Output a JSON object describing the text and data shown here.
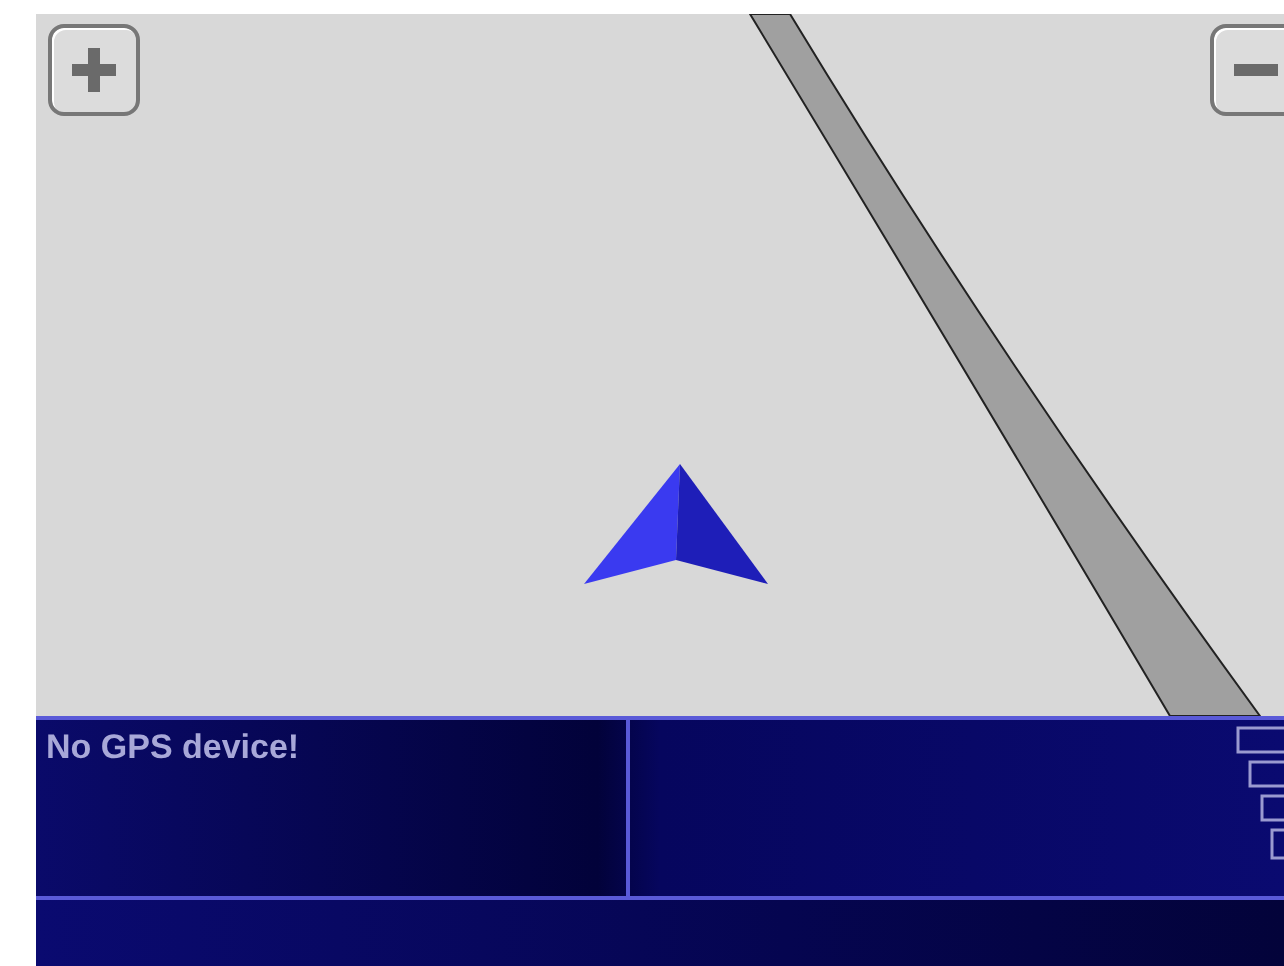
{
  "status_panel": {
    "message": "No GPS device!"
  }
}
